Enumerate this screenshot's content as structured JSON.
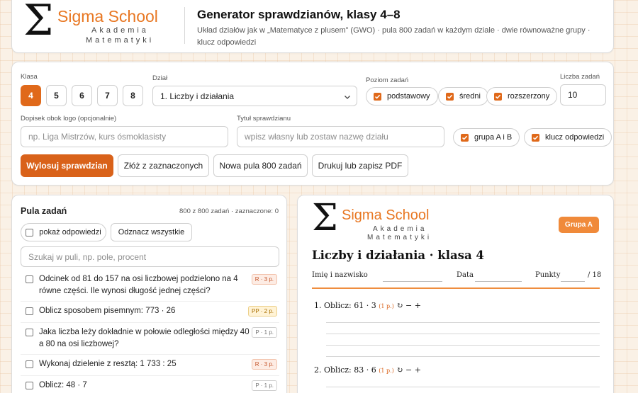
{
  "brand": {
    "name": "Sigma School",
    "sub1": "Akademia",
    "sub2": "Matematyki",
    "accent": "#e87722"
  },
  "header": {
    "title": "Generator sprawdzianów, klasy 4–8",
    "description": "Układ działów jak w „Matematyce z plusem” (GWO) · pula 800 zadań w każdym dziale · dwie równoważne grupy · klucz odpowiedzi"
  },
  "controls": {
    "grade_label": "Klasa",
    "grades": [
      "4",
      "5",
      "6",
      "7",
      "8"
    ],
    "selected_grade": "4",
    "section_label": "Dział",
    "section_value": "1. Liczby i działania",
    "level_label": "Poziom zadań",
    "levels": [
      {
        "label": "podstawowy",
        "checked": true
      },
      {
        "label": "średni",
        "checked": true
      },
      {
        "label": "rozszerzony",
        "checked": true
      }
    ],
    "count_label": "Liczba zadań",
    "count_value": "10",
    "logo_note_label": "Dopisek obok logo (opcjonalnie)",
    "logo_note_placeholder": "np. Liga Mistrzów, kurs ósmoklasisty",
    "test_title_label": "Tytuł sprawdzianu",
    "test_title_placeholder": "wpisz własny lub zostaw nazwę działu",
    "option_groups": "grupa A i B",
    "option_key": "klucz odpowiedzi",
    "buttons": {
      "draw": "Wylosuj sprawdzian",
      "compose": "Złóż z zaznaczonych",
      "new_pool": "Nowa pula 800 zadań",
      "print": "Drukuj lub zapisz PDF"
    }
  },
  "pool": {
    "title": "Pula zadań",
    "count": "800 z 800 zadań · zaznaczone: 0",
    "show_answers": "pokaż odpowiedzi",
    "select_all": "Odznacz wszystkie",
    "search_placeholder": "Szukaj w puli, np. pole, procent",
    "tasks": [
      {
        "text": "Odcinek od 81 do 157 na osi liczbowej podzielono na 4 równe części. Ile wynosi długość jednej części?",
        "badge": "R · 3 p.",
        "level": "R"
      },
      {
        "text": "Oblicz sposobem pisemnym: 773 · 26",
        "badge": "PP · 2 p.",
        "level": "PP"
      },
      {
        "text": "Jaka liczba leży dokładnie w połowie odległości między 40 a 80 na osi liczbowej?",
        "badge": "P · 1 p.",
        "level": "P"
      },
      {
        "text": "Wykonaj dzielenie z resztą: 1 733 : 25",
        "badge": "R · 3 p.",
        "level": "R"
      },
      {
        "text": "Oblicz: 48 · 7",
        "badge": "P · 1 p.",
        "level": "P"
      }
    ]
  },
  "preview": {
    "group": "Grupa A",
    "title": "Liczby i działania · klasa 4",
    "name_label": "Imię i nazwisko",
    "date_label": "Data",
    "points_label": "Punkty",
    "points_total": "/ 18",
    "questions": [
      {
        "num": "1.",
        "text": "Oblicz: 61 · 3",
        "points": "(1 p.)",
        "tools": "↻ − +"
      },
      {
        "num": "2.",
        "text": "Oblicz: 83 · 6",
        "points": "(1 p.)",
        "tools": "↻ − +"
      }
    ]
  }
}
